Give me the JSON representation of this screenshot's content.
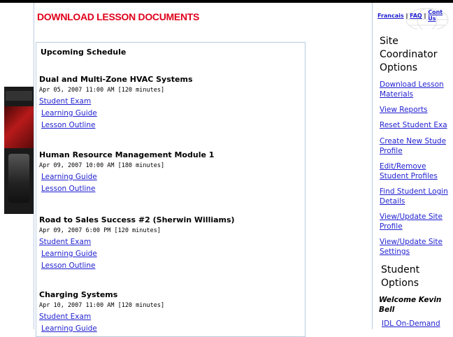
{
  "page": {
    "title": "DOWNLOAD LESSON DOCUMENTS"
  },
  "schedule": {
    "heading": "Upcoming Schedule",
    "courses": [
      {
        "title": "Dual and Multi-Zone HVAC Systems",
        "date": "Apr 05, 2007 11:00 AM [120 minutes]",
        "links": [
          "Student Exam",
          "Learning Guide",
          "Lesson Outline"
        ]
      },
      {
        "title": "Human Resource Management Module 1",
        "date": "Apr 09, 2007 10:00 AM [180 minutes]",
        "links": [
          "Learning Guide",
          "Lesson Outline"
        ]
      },
      {
        "title": "Road to Sales Success #2 (Sherwin Williams)",
        "date": "Apr 09, 2007 6:00 PM [120 minutes]",
        "links": [
          "Student Exam",
          "Learning Guide",
          "Lesson Outline"
        ]
      },
      {
        "title": "Charging Systems",
        "date": "Apr 10, 2007 11:00 AM [120 minutes]",
        "links": [
          "Student Exam",
          "Learning Guide"
        ]
      }
    ]
  },
  "toplinks": {
    "francais": "Francais",
    "faq": "FAQ",
    "contact_line1": "Cont",
    "contact_line2": "Us",
    "sep": "|"
  },
  "coordinator": {
    "heading_line1": "Site",
    "heading_line2": "Coordinator",
    "heading_line3": "Options",
    "links": [
      [
        "Download Lesson",
        "Materials"
      ],
      [
        "View Reports"
      ],
      [
        "Reset Student Exa"
      ],
      [
        "Create New Stude",
        "Profile"
      ],
      [
        "Edit/Remove",
        "Student Profiles"
      ],
      [
        "Find Student Login",
        "Details"
      ],
      [
        "View/Update Site",
        "Profile"
      ],
      [
        "View/Update Site",
        "Settings"
      ]
    ]
  },
  "student": {
    "heading_line1": "Student",
    "heading_line2": "Options",
    "welcome_line1": "Welcome Kevin",
    "welcome_line2": "Bell",
    "link": "IDL On-Demand"
  }
}
